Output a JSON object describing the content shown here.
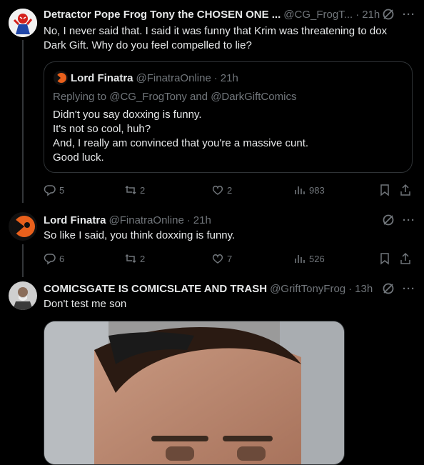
{
  "tweets": [
    {
      "name": "Detractor Pope Frog Tony the CHOSEN ONE ...",
      "handle": "@CG_FrogT...",
      "time": "21h",
      "text": "No, I never said that. I said it was funny that Krim was threatening to dox Dark Gift. Why do you feel compelled to lie?",
      "quote": {
        "name": "Lord Finatra",
        "handle": "@FinatraOnline",
        "time": "21h",
        "replying_prefix": "Replying to",
        "replying_to_1": "@CG_FrogTony",
        "replying_and": "and",
        "replying_to_2": "@DarkGiftComics",
        "lines": [
          "Didn't you say doxxing is funny.",
          "It's not so cool, huh?",
          "And, I really am convinced that you're a massive cunt.",
          "Good luck."
        ]
      },
      "replies": "5",
      "reposts": "2",
      "likes": "2",
      "views": "983"
    },
    {
      "name": "Lord Finatra",
      "handle": "@FinatraOnline",
      "time": "21h",
      "text": "So like I said, you think doxxing is funny.",
      "replies": "6",
      "reposts": "2",
      "likes": "7",
      "views": "526"
    },
    {
      "name": "COMICSGATE IS COMICSLATE AND TRASH",
      "handle": "@GriftTonyFrog",
      "time": "13h",
      "text": "Don't test me son"
    }
  ],
  "separator": "·",
  "icons": [
    "grok-icon",
    "more-icon",
    "reply-icon",
    "repost-icon",
    "like-icon",
    "views-icon",
    "bookmark-icon",
    "share-icon"
  ],
  "colors": {
    "background": "#000000",
    "text": "#e7e9ea",
    "secondary": "#71767b",
    "border": "#2f3336"
  }
}
